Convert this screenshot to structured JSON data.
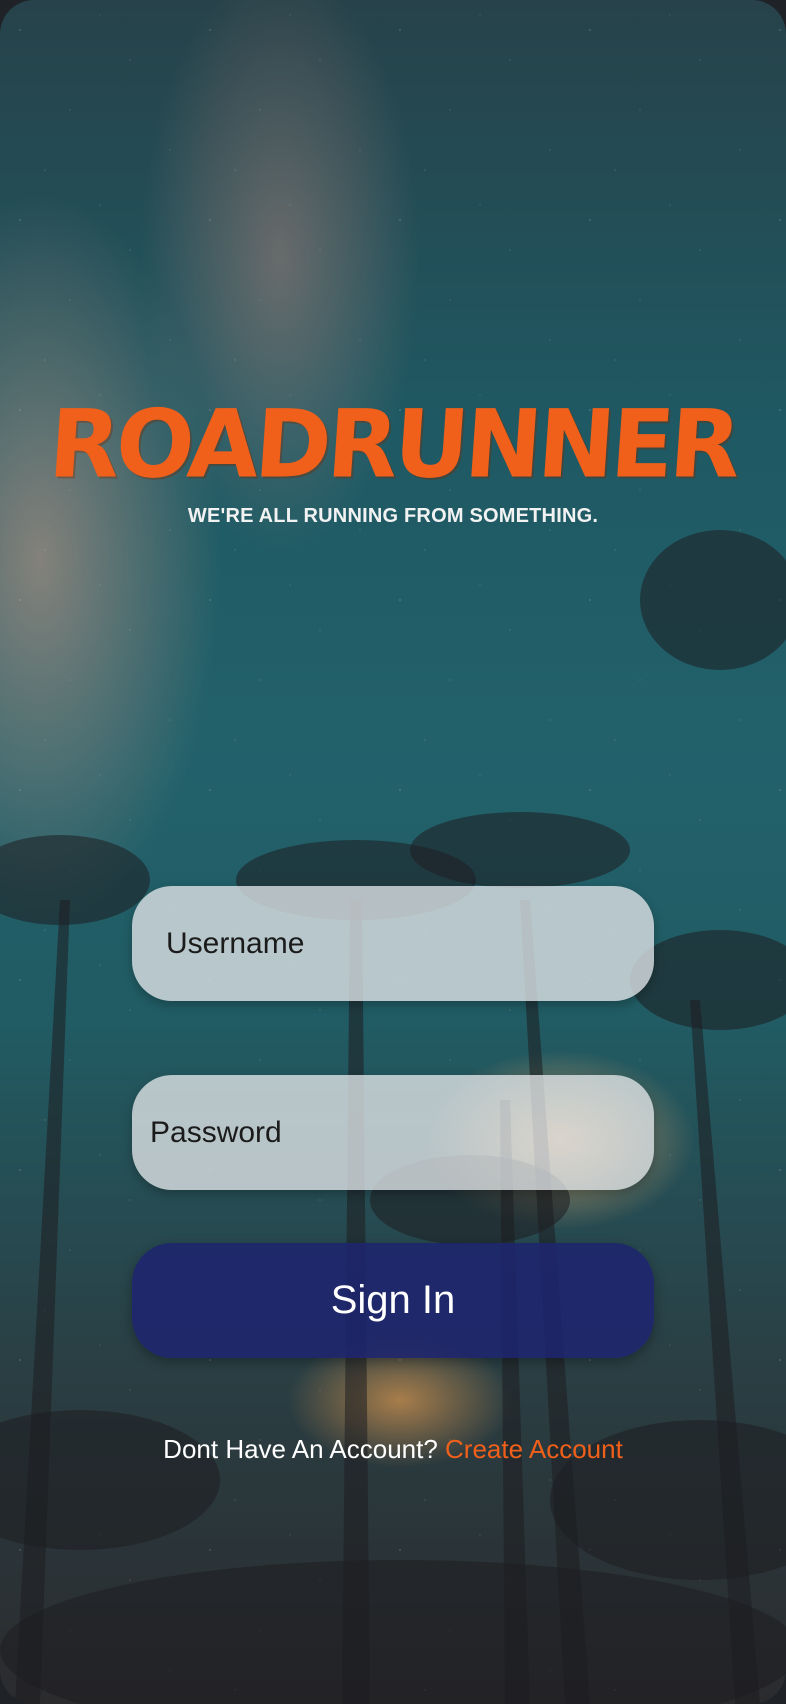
{
  "app": {
    "logo_text": "ROADRUNNER",
    "tagline": "WE'RE ALL RUNNING FROM SOMETHING."
  },
  "form": {
    "username_placeholder": "Username",
    "password_placeholder": "Password",
    "signin_label": "Sign In"
  },
  "footer": {
    "prompt": "Dont Have An Account?",
    "link_label": "Create Account"
  },
  "colors": {
    "accent": "#f0601a",
    "button": "#1e246e"
  }
}
